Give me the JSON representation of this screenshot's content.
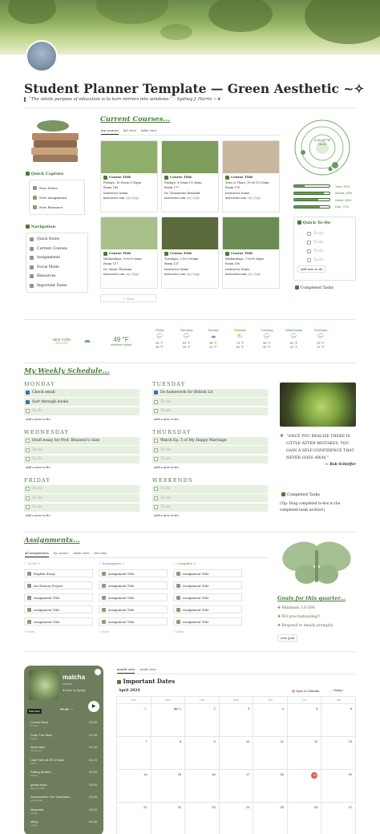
{
  "header": {
    "title": "Student Planner Template — Green Aesthetic ~✧",
    "quote": "“The whole purpose of education is to turn mirrors into windows.” – Sydney J. Harris ~★"
  },
  "current_courses": {
    "heading": "Current Courses...",
    "tabs": [
      "my courses",
      "list view",
      "table view"
    ],
    "courses": [
      {
        "title": "Course Title",
        "schedule": "Fridays, 10:00am-1:00pm",
        "room": "Room 188",
        "instructor": "Instructor Name",
        "email": "instructor.com",
        "emailtag": "ca/...logo",
        "img": "#8fae6a"
      },
      {
        "title": "Course Title",
        "schedule": "Fridays, 9:00am-11:30am",
        "room": "Room 177",
        "instructor": "Dr. Clementine Rosalind",
        "email": "instructor.com",
        "emailtag": "ca/...logo",
        "img": "#7e9c5a"
      },
      {
        "title": "Course Title",
        "schedule": "Tues & Thurs, 10:30-11:50am",
        "room": "Room 170",
        "instructor": "Instructor Name",
        "email": "instructor.com",
        "emailtag": "ca/...logo",
        "img": "#c8b79e"
      },
      {
        "title": "Course Title",
        "schedule": "Wednesdays, 9:00-9:50am",
        "room": "Room 157",
        "instructor": "Dr. Susan Thronnia",
        "email": "instructor.com",
        "emailtag": "ca/...logo",
        "img": "#a9c08a"
      },
      {
        "title": "Course Title",
        "schedule": "Tuesdays, 2:10-5:00pm",
        "room": "Room 157",
        "instructor": "Instructor Name",
        "email": "instructor.com",
        "emailtag": "ca/...logo",
        "img": "#5a6a3a"
      },
      {
        "title": "Course Title",
        "schedule": "Wednesdays, 7:00-8:30pm",
        "room": "Room 190",
        "instructor": "Instructor Name",
        "email": "instructor.com",
        "emailtag": "ca/...logo",
        "img": "#6b8c55"
      }
    ],
    "new_label": "+ New"
  },
  "quick_capture": {
    "heading": "Quick Capture",
    "items": [
      "New Notes",
      "New Assignment",
      "New Resource"
    ]
  },
  "navigation": {
    "heading": "Navigation",
    "items": [
      "Quick Notes",
      "Current Courses",
      "Assignments",
      "Focus Mode",
      "Resources",
      "Important Dates"
    ]
  },
  "clock": {
    "time": "5:16:26 PM",
    "date": "04-24"
  },
  "progress": {
    "rows": [
      {
        "label": "Year: 30%",
        "value": 0.3
      },
      {
        "label": "Month: 83%",
        "value": 0.83
      },
      {
        "label": "Week: 68%",
        "value": 0.68
      },
      {
        "label": "Day: 72%",
        "value": 0.72
      }
    ]
  },
  "quick_todo": {
    "heading": "Quick To-Do",
    "items": [
      "To-do",
      "To-do",
      "To-do",
      "To-do"
    ],
    "add_label": "add new to-do",
    "completed": "Completed Tasks"
  },
  "weather": {
    "location": "NEW YORK",
    "sublocation": "WEATHER",
    "current_temp": "49 °F",
    "current_desc": "overcast clouds",
    "days": [
      {
        "name": "Friday",
        "hi": "54 °F",
        "lo": "46 °F",
        "icon": "cloud-rain-icon"
      },
      {
        "name": "Saturday",
        "hi": "63 °F",
        "lo": "49 °F",
        "icon": "cloud-rain-icon"
      },
      {
        "name": "Sunday",
        "hi": "58 °F",
        "lo": "41 °F",
        "icon": "cloud-icon"
      },
      {
        "name": "Monday",
        "hi": "79 °F",
        "lo": "50 °F",
        "icon": "partly-sunny-icon"
      },
      {
        "name": "Tuesday",
        "hi": "60 °F",
        "lo": "52 °F",
        "icon": "cloud-rain-icon"
      },
      {
        "name": "Wednesday",
        "hi": "62 °F",
        "lo": "42 °F",
        "icon": "cloud-rain-icon"
      },
      {
        "name": "Thursday",
        "hi": "53 °F",
        "lo": "37 °F",
        "icon": "cloud-rain-icon"
      }
    ]
  },
  "weekly": {
    "heading": "My Weekly Schedule...",
    "add_label": "add a new to-do",
    "days": [
      {
        "name": "MONDAY",
        "items": [
          {
            "text": "Check email",
            "done": true
          },
          {
            "text": "Sort through books",
            "done": true
          },
          {
            "text": "To-do",
            "done": false
          }
        ]
      },
      {
        "name": "TUESDAY",
        "items": [
          {
            "text": "Do homework for British Lit",
            "done": true
          },
          {
            "text": "To-do",
            "done": false
          },
          {
            "text": "To-do",
            "done": false
          }
        ]
      },
      {
        "name": "WEDNESDAY",
        "items": [
          {
            "text": "Draft essay for Prof. Branson's class",
            "done": false
          },
          {
            "text": "To-do",
            "done": false
          },
          {
            "text": "To-do",
            "done": false
          }
        ]
      },
      {
        "name": "THURSDAY",
        "items": [
          {
            "text": "Watch Ep. 5 of My Happy Marriage",
            "done": false
          },
          {
            "text": "To-do",
            "done": false
          },
          {
            "text": "To-do",
            "done": false
          }
        ]
      },
      {
        "name": "FRIDAY",
        "items": [
          {
            "text": "To-do",
            "done": false
          },
          {
            "text": "To-do",
            "done": false
          },
          {
            "text": "To-do",
            "done": false
          }
        ]
      },
      {
        "name": "WEEKENDS",
        "items": [
          {
            "text": "To-do",
            "done": false
          },
          {
            "text": "To-do",
            "done": false
          },
          {
            "text": "To-do",
            "done": false
          }
        ]
      }
    ],
    "quote": "“ONCE YOU REALIZE THERE IS LITTLE AFTER MISTAKES, YOU GAIN A SELF-CONFIDENCE THAT NEVER GOES AWAY.”",
    "quote_author": "— Bob Schieffer",
    "completed": "Completed Tasks",
    "tip": "(Tip: Drag completed to-dos to the completed tasks archive!)"
  },
  "assignments": {
    "heading": "Assignments...",
    "tabs": [
      "all assignments",
      "by course",
      "table view",
      "list view"
    ],
    "columns": [
      {
        "name": "To-do",
        "count": "5",
        "items": [
          "English Essay",
          "Art History Project",
          "Assignment Title",
          "Assignment Title",
          "Assignment Title"
        ]
      },
      {
        "name": "In progress",
        "count": "5",
        "items": [
          "Assignment Title",
          "Assignment Title",
          "Assignment Title",
          "Assignment Title",
          "Assignment Title"
        ]
      },
      {
        "name": "Complete",
        "count": "5",
        "items": [
          "Assignment Title",
          "Assignment Title",
          "Assignment Title",
          "Assignment Title",
          "Assignment Title"
        ]
      }
    ],
    "new_label": "+ New"
  },
  "goals": {
    "heading": "Goals for this quarter...",
    "items": [
      "Minimum 3.8 GPA",
      "NO procrastinating!!",
      "Respond to emails promptly"
    ],
    "new_label": "new goal"
  },
  "music": {
    "title": "matcha",
    "subtitle": "sounds",
    "save_label": "Save on Spotify",
    "preview": "PREVIEW",
    "tracks": [
      {
        "name": "Lovers Rock",
        "artist": "TV Girl",
        "time": "03:33"
      },
      {
        "name": "From The Start",
        "artist": "Laufey",
        "time": "02:49"
      },
      {
        "name": "lmwf fusei",
        "artist": "Tamamoru",
        "time": "02:40"
      },
      {
        "name": "Last Train At 25 O'clock",
        "artist": "Lamp",
        "time": "04:03"
      },
      {
        "name": "Falling Behind",
        "artist": "Laufey",
        "time": "02:53"
      },
      {
        "name": "peach eyes",
        "artist": "wave to earth",
        "time": "03:00"
      },
      {
        "name": "Summertime The Gershwin...",
        "artist": "Laufey Ella",
        "time": "03:58"
      },
      {
        "name": "Magnolia",
        "artist": "Laufey",
        "time": "03:09"
      },
      {
        "name": "Misty",
        "artist": "Laufey",
        "time": "02:45"
      }
    ]
  },
  "calendar": {
    "tabs": [
      "month view",
      "week view"
    ],
    "heading": "Important Dates",
    "month": "April 2024",
    "open_label": "Open in Calendar",
    "today_label": "Today",
    "weekdays": [
      "Sun",
      "Mon",
      "Tue",
      "Wed",
      "Thu",
      "Fri",
      "Sat"
    ],
    "weeks": [
      [
        "31",
        "Apr 1",
        "2",
        "3",
        "4",
        "5",
        "6"
      ],
      [
        "7",
        "8",
        "9",
        "10",
        "11",
        "12",
        "13"
      ],
      [
        "14",
        "15",
        "16",
        "17",
        "18",
        "19",
        "20"
      ],
      [
        "21",
        "22",
        "23",
        "24",
        "25",
        "26",
        "27"
      ]
    ],
    "today": "19",
    "accent": "#e05a4a"
  }
}
